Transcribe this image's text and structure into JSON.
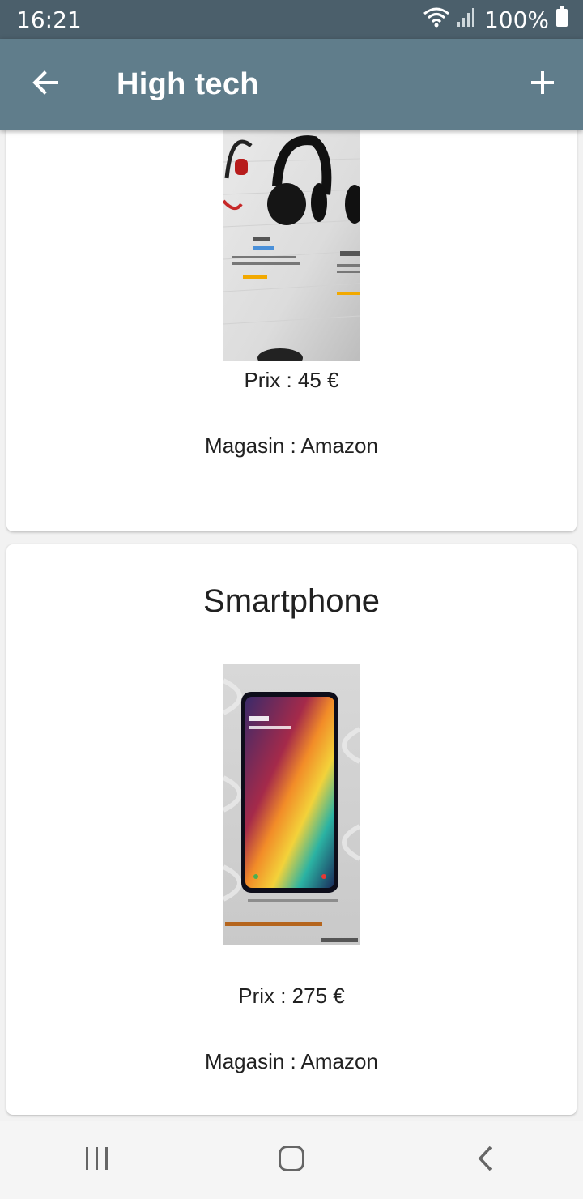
{
  "status_bar": {
    "time": "16:21",
    "battery": "100%"
  },
  "app_bar": {
    "title": "High tech",
    "back_icon": "arrow-back-icon",
    "add_icon": "add-icon"
  },
  "products": [
    {
      "name": "",
      "image": "headphones-photo",
      "price": "Prix : 45 €",
      "store": "Magasin : Amazon"
    },
    {
      "name": "Smartphone",
      "image": "smartphone-photo",
      "price": "Prix : 275 €",
      "store": "Magasin : Amazon"
    }
  ],
  "nav_bar": {
    "recents_icon": "recents-icon",
    "home_icon": "home-icon",
    "back_icon": "nav-back-icon"
  },
  "colors": {
    "status_bar": "#4b5f6b",
    "app_bar": "#607d8b",
    "card": "#ffffff",
    "background": "#f2f2f2"
  }
}
